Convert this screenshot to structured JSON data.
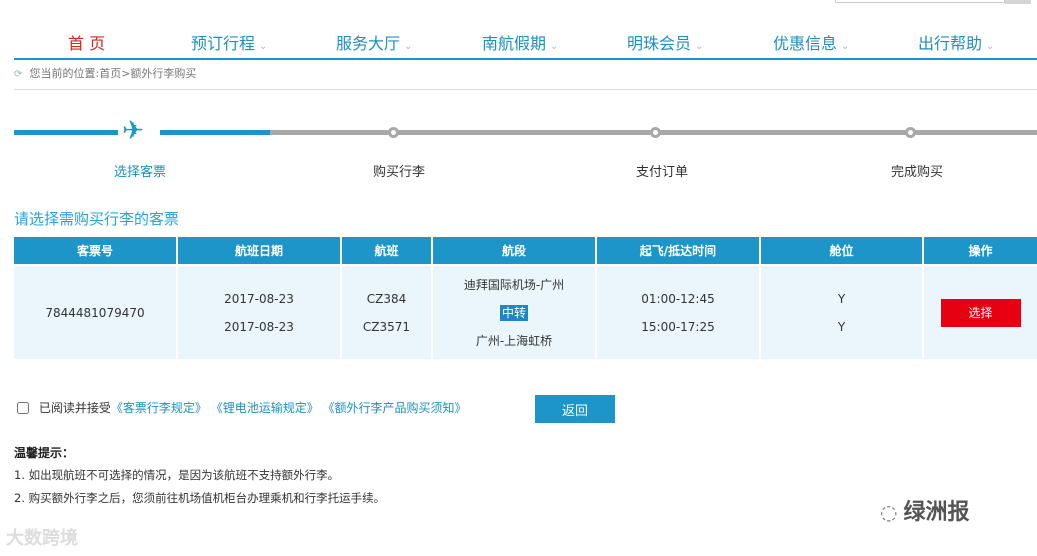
{
  "nav": {
    "items": [
      {
        "label": "首 页",
        "chevron": false
      },
      {
        "label": "预订行程",
        "chevron": true
      },
      {
        "label": "服务大厅",
        "chevron": true
      },
      {
        "label": "南航假期",
        "chevron": true
      },
      {
        "label": "明珠会员",
        "chevron": true
      },
      {
        "label": "优惠信息",
        "chevron": true
      },
      {
        "label": "出行帮助",
        "chevron": true
      }
    ],
    "chevron_glyph": "⌄",
    "accent": "#1d95c9",
    "home_color": "#d7231f"
  },
  "breadcrumb": {
    "text": "您当前的位置:首页>额外行李购买"
  },
  "steps": [
    {
      "label": "选择客票",
      "active": true
    },
    {
      "label": "购买行李",
      "active": false
    },
    {
      "label": "支付订单",
      "active": false
    },
    {
      "label": "完成购买",
      "active": false
    }
  ],
  "section_title": "请选择需购买行李的客票",
  "table": {
    "headers": [
      "客票号",
      "航班日期",
      "航班",
      "航段",
      "起飞/抵达时间",
      "舱位",
      "操作"
    ],
    "row": {
      "ticket_no": "7844481079470",
      "dates": [
        "2017-08-23",
        "2017-08-23"
      ],
      "flights": [
        "CZ384",
        "CZ3571"
      ],
      "route_leg1": "迪拜国际机场-广州",
      "transfer_label": "中转",
      "route_leg2": "广州-上海虹桥",
      "times": [
        "01:00-12:45",
        "15:00-17:25"
      ],
      "cabins": [
        "Y",
        "Y"
      ],
      "select_label": "选择"
    }
  },
  "agree": {
    "prefix": "已阅读并接受",
    "link1": "《客票行李规定》",
    "link2": "《锂电池运输规定》",
    "link3": "《额外行李产品购买须知》"
  },
  "back_label": "返回",
  "tips": {
    "title": "温馨提示：",
    "items": [
      "1. 如出现航班不可选择的情况，是因为该航班不支持额外行李。",
      "2. 购买额外行李之后，您须前往机场值机柜台办理乘机和行李托运手续。"
    ]
  },
  "watermarks": {
    "right": "绿洲报",
    "left": "大数跨境"
  }
}
